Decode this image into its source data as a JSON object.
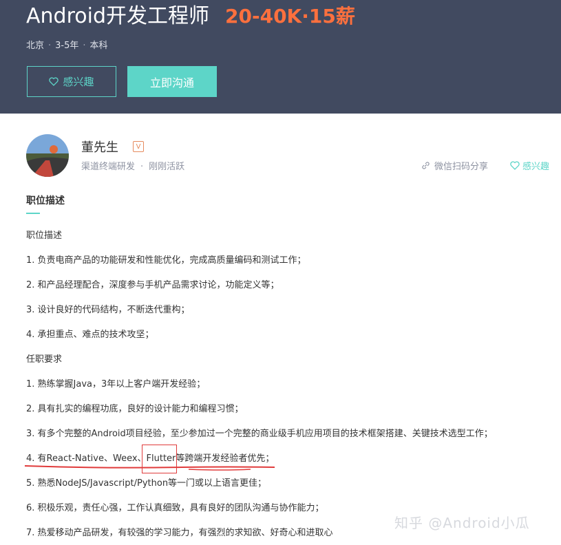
{
  "job": {
    "title": "Android开发工程师",
    "salary": "20-40K·15薪",
    "city": "北京",
    "experience": "3-5年",
    "education": "本科",
    "interest_button": "感兴趣",
    "chat_button": "立即沟通"
  },
  "recruiter": {
    "name": "董先生",
    "badge": "V",
    "title": "渠道终端研发",
    "status": "刚刚活跃",
    "share_label": "微信扫码分享",
    "interest_label": "感兴趣"
  },
  "description": {
    "section_title": "职位描述",
    "lines": [
      "职位描述",
      "1. 负责电商产品的功能研发和性能优化，完成高质量编码和测试工作；",
      "2. 和产品经理配合，深度参与手机产品需求讨论，功能定义等；",
      "3. 设计良好的代码结构，不断迭代重构；",
      "4. 承担重点、难点的技术攻坚；",
      "任职要求",
      "1. 熟练掌握Java，3年以上客户端开发经验；",
      "2. 具有扎实的编程功底，良好的设计能力和编程习惯；",
      "3. 有多个完整的Android项目经验，至少参加过一个完整的商业级手机应用项目的技术框架搭建、关键技术选型工作；",
      "4. 有React-Native、Weex、Flutter等跨端开发经验者优先；",
      "5. 熟悉NodeJS/Javascript/Python等一门或以上语言更佳；",
      "6. 积极乐观，责任心强，工作认真细致，具有良好的团队沟通与协作能力；",
      "7. 热爱移动产品研发，有较强的学习能力，有强烈的求知欲、好奇心和进取心"
    ]
  },
  "watermark": "知乎 @Android小瓜",
  "colors": {
    "header_bg": "#414a60",
    "accent": "#5dd5c8",
    "salary": "#fc703e",
    "annotation": "#e03a3a"
  }
}
